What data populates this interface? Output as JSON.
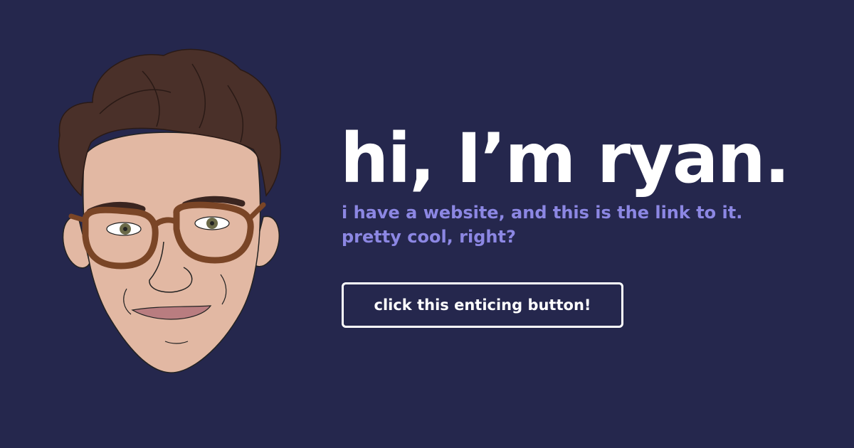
{
  "hero": {
    "title": "hi, I’m ryan."
  },
  "tagline": {
    "line1": "i have a website, and this is the link to it.",
    "line2": "pretty cool, right?"
  },
  "cta": {
    "label": "click this enticing button!"
  },
  "colors": {
    "background": "#25274d",
    "title": "#ffffff",
    "tagline": "#8c87e3",
    "button_border": "#ffffff",
    "skin": "#e2b8a3",
    "hair": "#4a3029",
    "glasses": "#7a4526"
  },
  "portrait": {
    "icon": "cartoon-face-illustration"
  }
}
